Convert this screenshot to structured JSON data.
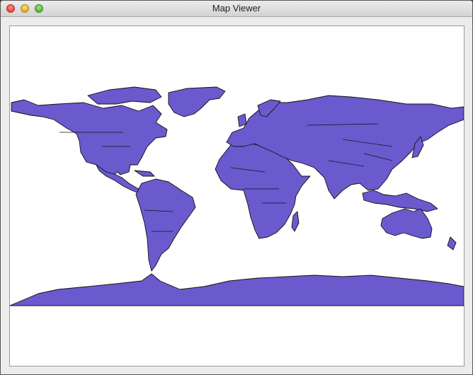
{
  "window": {
    "title": "Map Viewer"
  },
  "map": {
    "land_color": "#6a5acd",
    "outline_color": "#111111",
    "ocean_color": "#ffffff"
  }
}
